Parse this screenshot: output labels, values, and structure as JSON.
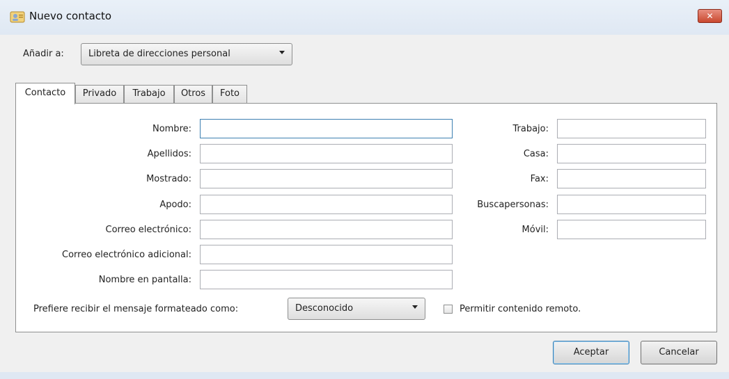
{
  "window": {
    "title": "Nuevo contacto",
    "icon": "contact-card-icon",
    "close_icon": "close-icon"
  },
  "addto": {
    "label": "Añadir a:",
    "selected": "Libreta de direcciones personal"
  },
  "tabs": [
    {
      "label": "Contacto",
      "active": true
    },
    {
      "label": "Privado",
      "active": false
    },
    {
      "label": "Trabajo",
      "active": false
    },
    {
      "label": "Otros",
      "active": false
    },
    {
      "label": "Foto",
      "active": false
    }
  ],
  "left_fields": [
    {
      "label": "Nombre:",
      "value": "",
      "focused": true
    },
    {
      "label": "Apellidos:",
      "value": ""
    },
    {
      "label": "Mostrado:",
      "value": ""
    },
    {
      "label": "Apodo:",
      "value": ""
    },
    {
      "label": "Correo electrónico:",
      "value": ""
    },
    {
      "label": "Correo electrónico adicional:",
      "value": ""
    },
    {
      "label": "Nombre en pantalla:",
      "value": ""
    }
  ],
  "right_fields": [
    {
      "label": "Trabajo:",
      "value": ""
    },
    {
      "label": "Casa:",
      "value": ""
    },
    {
      "label": "Fax:",
      "value": ""
    },
    {
      "label": "Buscapersonas:",
      "value": ""
    },
    {
      "label": "Móvil:",
      "value": ""
    }
  ],
  "format": {
    "label": "Prefiere recibir el mensaje formateado como:",
    "selected": "Desconocido"
  },
  "remote": {
    "label": "Permitir contenido remoto.",
    "checked": false
  },
  "buttons": {
    "accept": "Aceptar",
    "cancel": "Cancelar"
  },
  "colors": {
    "accent": "#3c7fb1",
    "close": "#c9482f"
  }
}
